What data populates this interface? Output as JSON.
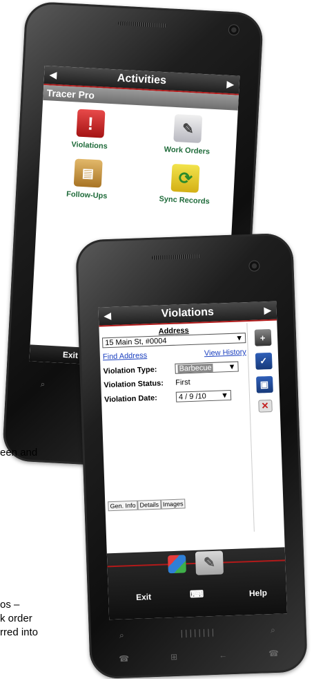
{
  "back_phone": {
    "title": "Activities",
    "app_name": "Tracer Pro",
    "tiles": [
      {
        "label": "Violations",
        "icon": "alert-icon"
      },
      {
        "label": "Work Orders",
        "icon": "notepad-pencil-icon"
      },
      {
        "label": "Follow-Ups",
        "icon": "clipboard-icon"
      },
      {
        "label": "Sync Records",
        "icon": "sync-arrows-icon"
      }
    ],
    "exit_label": "Exit"
  },
  "front_phone": {
    "title": "Violations",
    "address_label": "Address",
    "address_value": "15 Main St, #0004",
    "find_address": "Find Address",
    "view_history": "View History",
    "violation_type_label": "Violation Type:",
    "violation_type_value": "Barbecue",
    "violation_status_label": "Violation Status:",
    "violation_status_value": "First",
    "violation_date_label": "Violation Date:",
    "violation_date_value": "4 / 9 /10",
    "tabs": [
      "Gen. Info",
      "Details",
      "Images"
    ],
    "exit_label": "Exit",
    "help_label": "Help",
    "side_icons": [
      "add-record-icon",
      "save-check-icon",
      "save-icon",
      "cancel-icon"
    ]
  },
  "captions": {
    "line1": "een and",
    "line2": "os –",
    "line3": "k order",
    "line4": "rred into"
  },
  "colors": {
    "accent_red": "#b21a1a",
    "label_green": "#1f6b3a",
    "link_blue": "#1a3fbf"
  }
}
